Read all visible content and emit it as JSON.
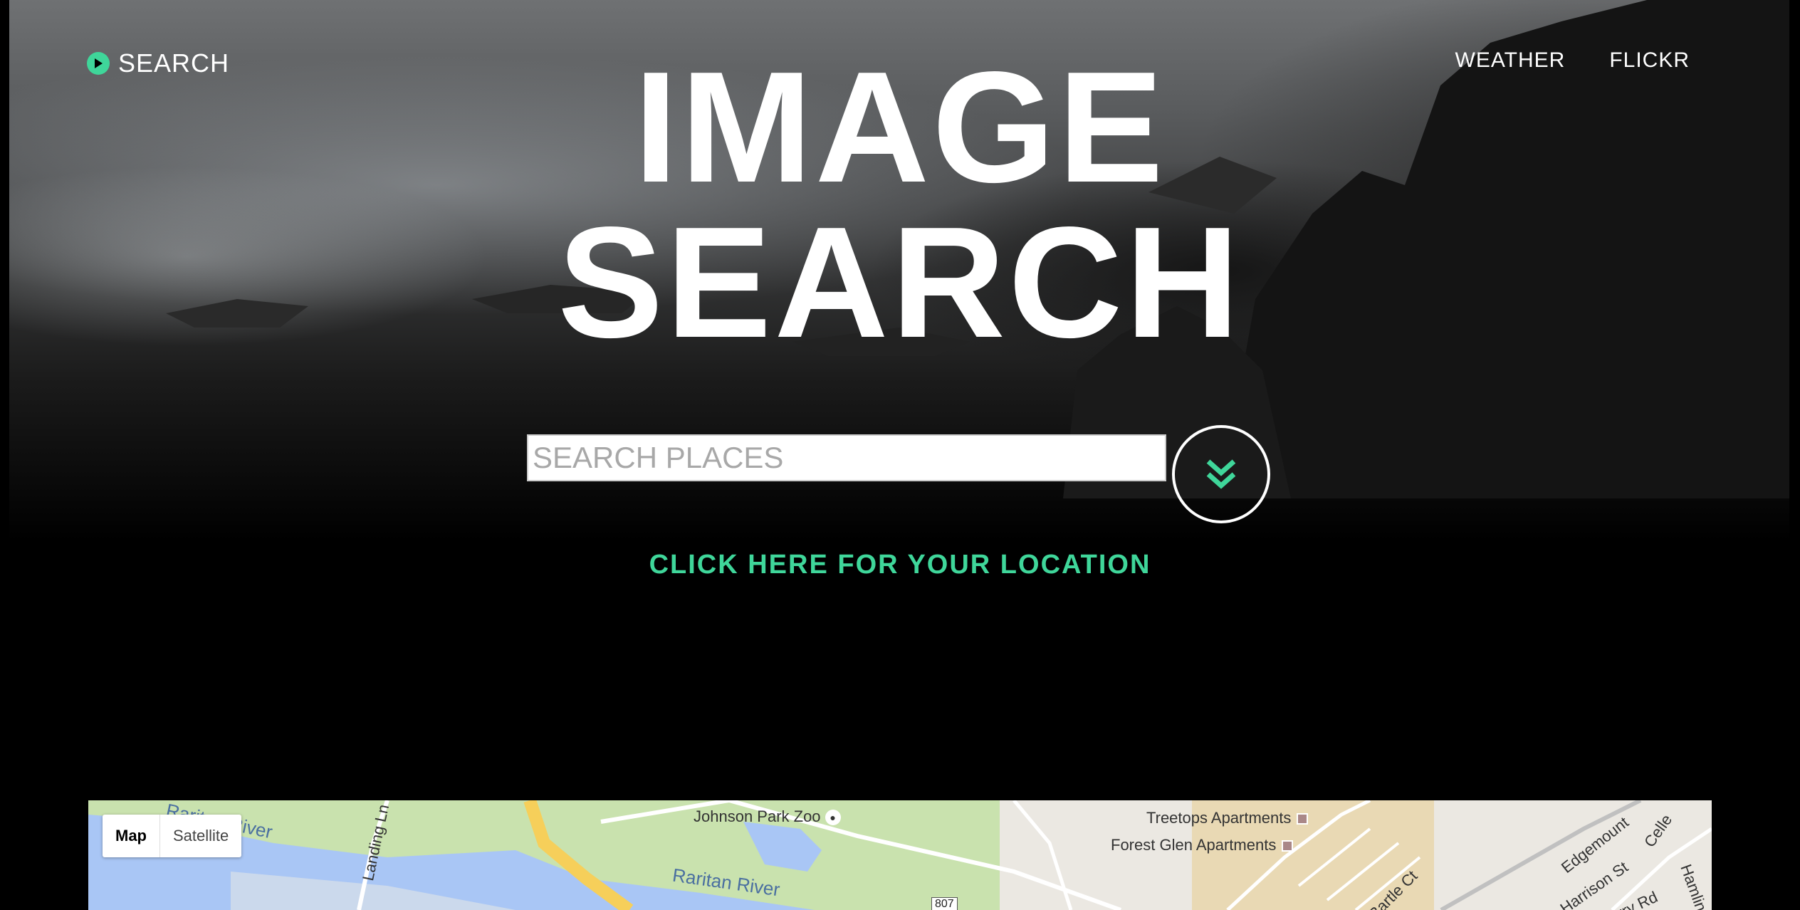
{
  "nav": {
    "logo_label": "SEARCH",
    "links": [
      "WEATHER",
      "FLICKR"
    ]
  },
  "hero": {
    "title_line1": "IMAGE",
    "title_line2": "SEARCH"
  },
  "search": {
    "placeholder": "SEARCH PLACES",
    "value": ""
  },
  "location_link": "CLICK HERE FOR YOUR LOCATION",
  "map": {
    "toggle": [
      "Map",
      "Satellite"
    ],
    "selected": "Map",
    "labels": {
      "river_1": "Raritan River",
      "river_2": "Raritan River",
      "zoo": "Johnson Park Zoo",
      "treetops": "Treetops Apartments",
      "forest_glen": "Forest Glen Apartments",
      "landing_ln": "Landing Ln",
      "bartle_ct": "Bartle Ct",
      "edgemount": "Edgemount",
      "harrison": "Harrison St",
      "cellar": "Celle",
      "hamlin": "Hamlin",
      "barry_rd": "Barry Rd",
      "route": "807"
    }
  },
  "colors": {
    "accent": "#3fd69a",
    "background": "#000000",
    "text": "#ffffff",
    "water": "#a9c6f5",
    "park": "#c6dfa9",
    "highway": "#f6cf5a"
  },
  "icons": {
    "logo": "play-circle-icon",
    "go_button": "double-chevron-down-icon",
    "zoo": "paw-icon"
  }
}
